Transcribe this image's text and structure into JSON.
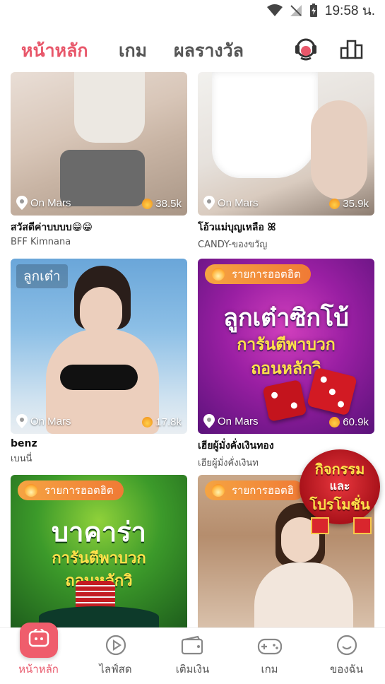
{
  "status_bar": {
    "time": "19:58 น."
  },
  "nav": {
    "tabs": [
      {
        "label": "หน้าหลัก",
        "active": true
      },
      {
        "label": "เกม",
        "active": false
      },
      {
        "label": "ผลรางวัล",
        "active": false
      }
    ],
    "icons": [
      "support-agent-icon",
      "ranking-podium-icon"
    ]
  },
  "feed": {
    "cards": [
      {
        "title": "สวัสดีค่าบบบบ😁😁",
        "subtitle": "BFF Kimnana",
        "location": "On Mars",
        "views": "38.5k"
      },
      {
        "title": "โอ้วแม่บุญเหลือ ꕤ",
        "subtitle": "CANDY-ของขวัญ",
        "location": "On Mars",
        "views": "35.9k"
      },
      {
        "title": "benz",
        "subtitle": "เบนนี่",
        "location": "On Mars",
        "views": "17.8k",
        "overlay_text": "ลูกเต๋า"
      },
      {
        "title": "เฮียผู้มั่งคั่งเงินทอง",
        "subtitle": "เฮียผู้มั่งคั่งเงินท",
        "location": "On Mars",
        "views": "60.9k",
        "badge": "รายการฮอตฮิต",
        "promo_line1": "ลูกเต๋าซิกโบ้",
        "promo_line2": "การันตีพาบวก",
        "promo_line3": "ถอนหลักวิ"
      },
      {
        "badge": "รายการฮอตฮิต",
        "promo_line1": "บาคาร่า",
        "promo_line2": "การันตีพาบวก",
        "promo_line3": "ถอนหลักวิ"
      },
      {
        "badge": "รายการฮอตฮิ"
      }
    ],
    "floating_promo": {
      "line1": "กิจกรรม",
      "line2": "และ",
      "line3": "โปรโมชั่น"
    }
  },
  "bottom_bar": {
    "items": [
      {
        "label": "หน้าหลัก",
        "icon": "home-icon",
        "active": true
      },
      {
        "label": "ไลฟ์สด",
        "icon": "live-play-icon",
        "active": false
      },
      {
        "label": "เติมเงิน",
        "icon": "wallet-icon",
        "active": false
      },
      {
        "label": "เกม",
        "icon": "gamepad-icon",
        "active": false
      },
      {
        "label": "ของฉัน",
        "icon": "smiley-icon",
        "active": false
      }
    ]
  },
  "colors": {
    "accent": "#e8576a",
    "badge_orange": "#f5a442"
  }
}
